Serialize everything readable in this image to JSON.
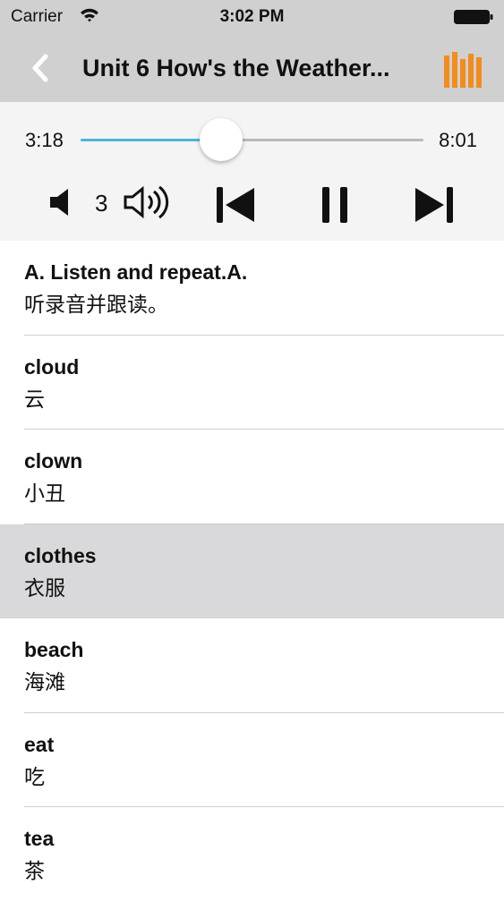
{
  "status_bar": {
    "carrier": "Carrier",
    "time": "3:02 PM"
  },
  "nav": {
    "title": "Unit 6 How's the Weather...",
    "accent_color": "#f28c1c"
  },
  "player": {
    "elapsed": "3:18",
    "total": "8:01",
    "progress_fraction": 0.41,
    "volume": "3",
    "progress_color": "#4cb4d9"
  },
  "items": [
    {
      "en": "A. Listen and repeat.A.",
      "cn": "听录音并跟读。",
      "selected": false
    },
    {
      "en": "cloud",
      "cn": "云",
      "selected": false
    },
    {
      "en": "clown",
      "cn": "小丑",
      "selected": false
    },
    {
      "en": "clothes",
      "cn": "衣服",
      "selected": true
    },
    {
      "en": "beach",
      "cn": "海滩",
      "selected": false
    },
    {
      "en": "eat",
      "cn": "吃",
      "selected": false
    },
    {
      "en": "tea",
      "cn": "茶",
      "selected": false
    }
  ]
}
